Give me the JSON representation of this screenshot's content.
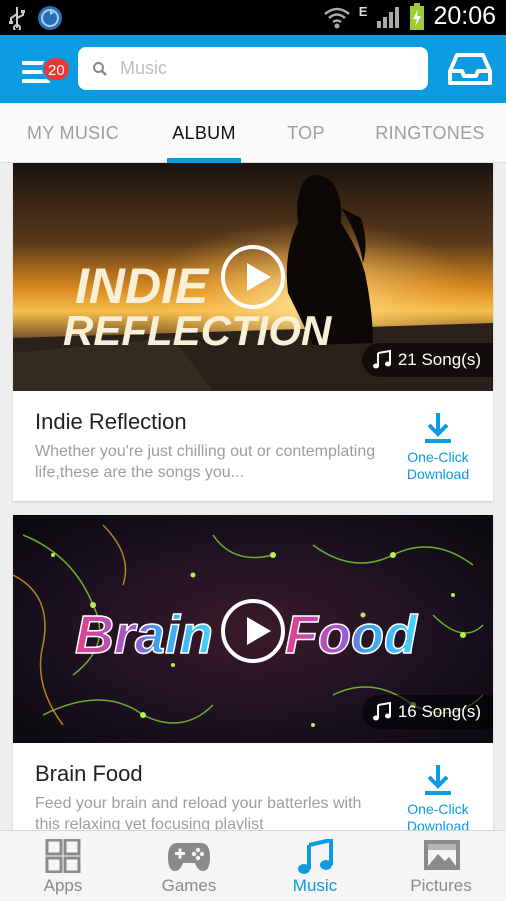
{
  "status_bar": {
    "time": "20:06",
    "network": "E",
    "icons": [
      "usb-icon",
      "sync-icon",
      "wifi-icon",
      "signal-icon",
      "battery-charging-icon"
    ]
  },
  "header": {
    "notification_count": "20",
    "search_placeholder": "Music",
    "icons": [
      "menu-icon",
      "search-icon",
      "inbox-icon"
    ]
  },
  "tabs": [
    {
      "label": "MY MUSIC",
      "active": false
    },
    {
      "label": "ALBUM",
      "active": true
    },
    {
      "label": "TOP",
      "active": false
    },
    {
      "label": "RINGTONES",
      "active": false
    }
  ],
  "albums": [
    {
      "cover_text": [
        "INDIE",
        "REFLECTION"
      ],
      "song_count": "21 Song(s)",
      "title": "Indie Reflection",
      "description": "Whether you're just chilling out or contemplating life,these are the songs you...",
      "download_label": [
        "One-Click",
        "Download"
      ]
    },
    {
      "cover_text": [
        "Brain",
        "Food"
      ],
      "song_count": "16 Song(s)",
      "title": "Brain Food",
      "description": "Feed your brain and reload your batterles with this relaxing yet focusing playlist",
      "download_label": [
        "One-Click",
        "Download"
      ]
    }
  ],
  "bottom_nav": [
    {
      "label": "Apps",
      "icon": "apps-grid-icon",
      "active": false
    },
    {
      "label": "Games",
      "icon": "gamepad-icon",
      "active": false
    },
    {
      "label": "Music",
      "icon": "music-note-icon",
      "active": true
    },
    {
      "label": "Pictures",
      "icon": "picture-icon",
      "active": false
    }
  ],
  "colors": {
    "accent": "#0a9be0",
    "badge": "#e53935",
    "inactive": "#9e9e9e"
  }
}
